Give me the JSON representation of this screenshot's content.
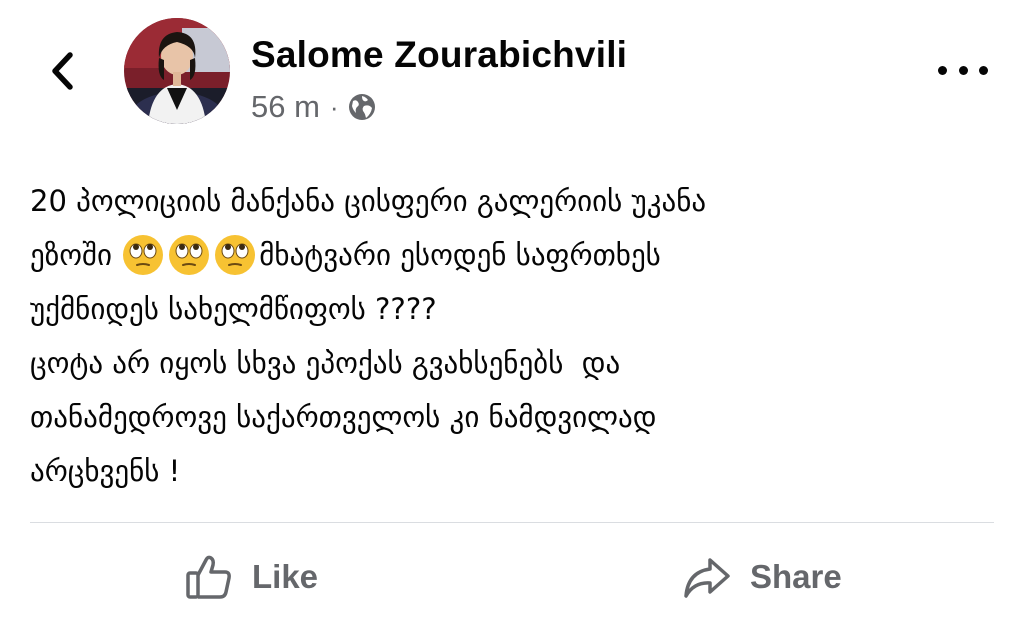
{
  "header": {
    "author_name": "Salome Zourabichvili",
    "time_ago": "56 m",
    "separator": "·",
    "privacy_icon": "globe-icon",
    "back_icon": "chevron-left-icon",
    "more_icon": "more-dots-icon"
  },
  "post": {
    "lines": [
      "20 პოლიციის მანქანა ცისფერი გალერიის უკანა",
      "მხატვარი ესოდენ საფრთხეს",
      "უქმნიდეს სახელმწიფოს ????",
      "ცოტა არ იყოს სხვა ეპოქას გვახსენებს  და",
      "თანამედროვე საქართველოს კი ნამდვილად",
      "არცხვენს !"
    ],
    "line2_prefix": "ეზოში ",
    "emoji_name": "face-with-rolling-eyes",
    "emoji_count": 3
  },
  "actions": {
    "like_label": "Like",
    "share_label": "Share",
    "like_icon": "thumbs-up-icon",
    "share_icon": "share-arrow-icon"
  },
  "colors": {
    "text": "#050505",
    "secondary": "#65676b",
    "divider": "#dadde1"
  }
}
